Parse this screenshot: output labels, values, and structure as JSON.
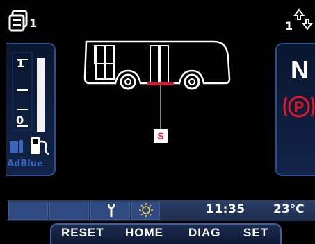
{
  "top_bar": {
    "menu_count": "1",
    "gear_count": "1"
  },
  "left_panel": {
    "gauge_labels": [
      "1",
      "0"
    ],
    "adblue_label": "AdBlue",
    "fuel_level_fraction": 1.0
  },
  "right_panel": {
    "gear": "N",
    "park_brake_symbol": "P"
  },
  "vehicle": {
    "door_badge": "S"
  },
  "status_bar": {
    "time": "11:35",
    "temperature": "23°C"
  },
  "menu": {
    "reset": "RESET",
    "home": "HOME",
    "diag": "DIAG",
    "set": "SET"
  },
  "colors": {
    "panel_border": "#29508e",
    "warning_red": "#e0182b",
    "adblue_blue": "#3a66b8"
  },
  "icons": [
    "menu-icon",
    "gear-shift-icon",
    "fuel-tank-icon",
    "fuel-pump-icon",
    "park-brake-icon",
    "wrench-icon",
    "sun-icon"
  ]
}
